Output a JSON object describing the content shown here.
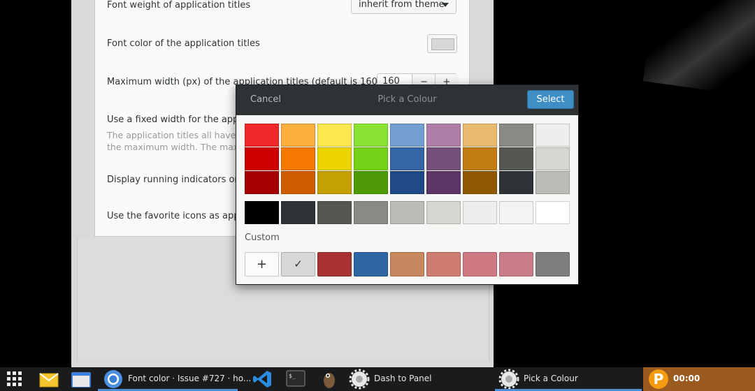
{
  "prefs": {
    "rows": [
      {
        "label": "Font weight of application titles",
        "control": "inherit from theme"
      },
      {
        "label": "Font color of the application titles"
      },
      {
        "label": "Maximum width (px) of the application titles (default is 160)",
        "value": "160"
      },
      {
        "label": "Use a fixed width for the applic",
        "desc1": "The application titles all have t",
        "desc2": "the maximum width. The maxin"
      },
      {
        "label": "Display running indicators on u"
      },
      {
        "label": "Use the favorite icons as applic"
      }
    ],
    "spin_minus": "−",
    "spin_plus": "+"
  },
  "dialog": {
    "cancel": "Cancel",
    "title": "Pick a Colour",
    "select": "Select",
    "palette_columns": [
      [
        "#ef2929",
        "#cc0000",
        "#a40000"
      ],
      [
        "#fcaf3e",
        "#f57900",
        "#ce5c00"
      ],
      [
        "#fce94f",
        "#edd400",
        "#c4a000"
      ],
      [
        "#8ae234",
        "#73d216",
        "#4e9a06"
      ],
      [
        "#729fcf",
        "#3465a4",
        "#204a87"
      ],
      [
        "#ad7fa8",
        "#75507b",
        "#5c3566"
      ],
      [
        "#e9b96e",
        "#c17d11",
        "#8f5902"
      ],
      [
        "#888a85",
        "#555753",
        "#2e3436"
      ],
      [
        "#eeeeec",
        "#d3d7cf",
        "#babdb6"
      ]
    ],
    "grays": [
      "#000000",
      "#2e3436",
      "#555753",
      "#888a85",
      "#babdb6",
      "#d3d7cf",
      "#eeeeec",
      "#f3f3f3",
      "#ffffff"
    ],
    "custom_label": "Custom",
    "custom_add": "+",
    "custom_selected_mark": "✓",
    "customs": [
      "#d8d8d8",
      "#a83232",
      "#2e66a3",
      "#c8875f",
      "#cf7d72",
      "#cf7a82",
      "#c97d88",
      "#7e7e7e"
    ]
  },
  "taskbar": {
    "chrome_label": "Font color · Issue #727 · ho...",
    "dash_label": "Dash to Panel",
    "picker_label": "Pick a Colour",
    "clock": "00:00",
    "clock_logo": "P"
  }
}
